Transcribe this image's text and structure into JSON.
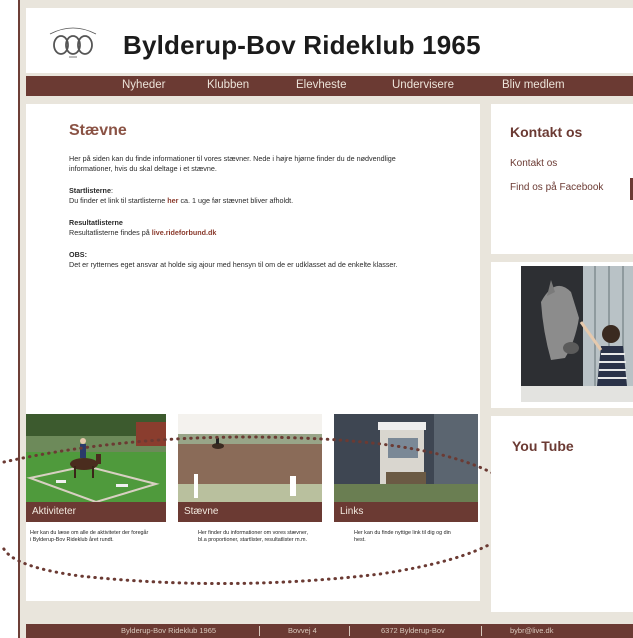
{
  "header": {
    "title": "Bylderup-Bov Rideklub 1965"
  },
  "nav": {
    "items": [
      "Nyheder",
      "Klubben",
      "Elevheste",
      "Undervisere",
      "Bliv medlem"
    ]
  },
  "main": {
    "title": "Stævne",
    "intro": "Her på siden kan du  finde informationer til vores stævner. Nede i højre hjørne finder du de nødvendlige informationer, hvis du skal deltage i et stævne.",
    "start_heading": "Startlisterne",
    "start_text_pre": "Du finder et link til startlisterne ",
    "start_link": "her",
    "start_text_post": " ca. 1 uge før stævnet bliver afholdt.",
    "result_heading": "Resultatlisterne",
    "result_text_pre": "Resultatlisterne findes på ",
    "result_link": "live.rideforbund.dk",
    "obs_heading": "OBS:",
    "obs_text": "Det er rytternes eget ansvar at holde sig ajour med hensyn til om de er udklasset ad de enkelte klasser."
  },
  "tiles": [
    {
      "caption": "Aktiviteter",
      "desc": "Her kan du læse om alle de aktiviteter der foregår i Bylderup-Bov Rideklub året rundt."
    },
    {
      "caption": "Stævne",
      "desc": "Her finder du informationer om vores stævner, bl.a proportioner, startlister, resultatlister m.m."
    },
    {
      "caption": "Links",
      "desc": "Her kan du finde nyttige link til dig og din hest."
    }
  ],
  "sidebar": {
    "contact_heading": "Kontakt os",
    "contact_link": "Kontakt os",
    "facebook_link": "Find os på Facebook",
    "youtube_heading": "You Tube"
  },
  "footer": {
    "items": [
      "Bylderup-Bov Rideklub 1965",
      "Bovvej 4",
      "6372 Bylderup-Bov",
      "bybr@live.dk"
    ]
  },
  "colors": {
    "brand": "#6b3a33",
    "title_accent": "#8a5244",
    "background": "#e9e5dc"
  }
}
